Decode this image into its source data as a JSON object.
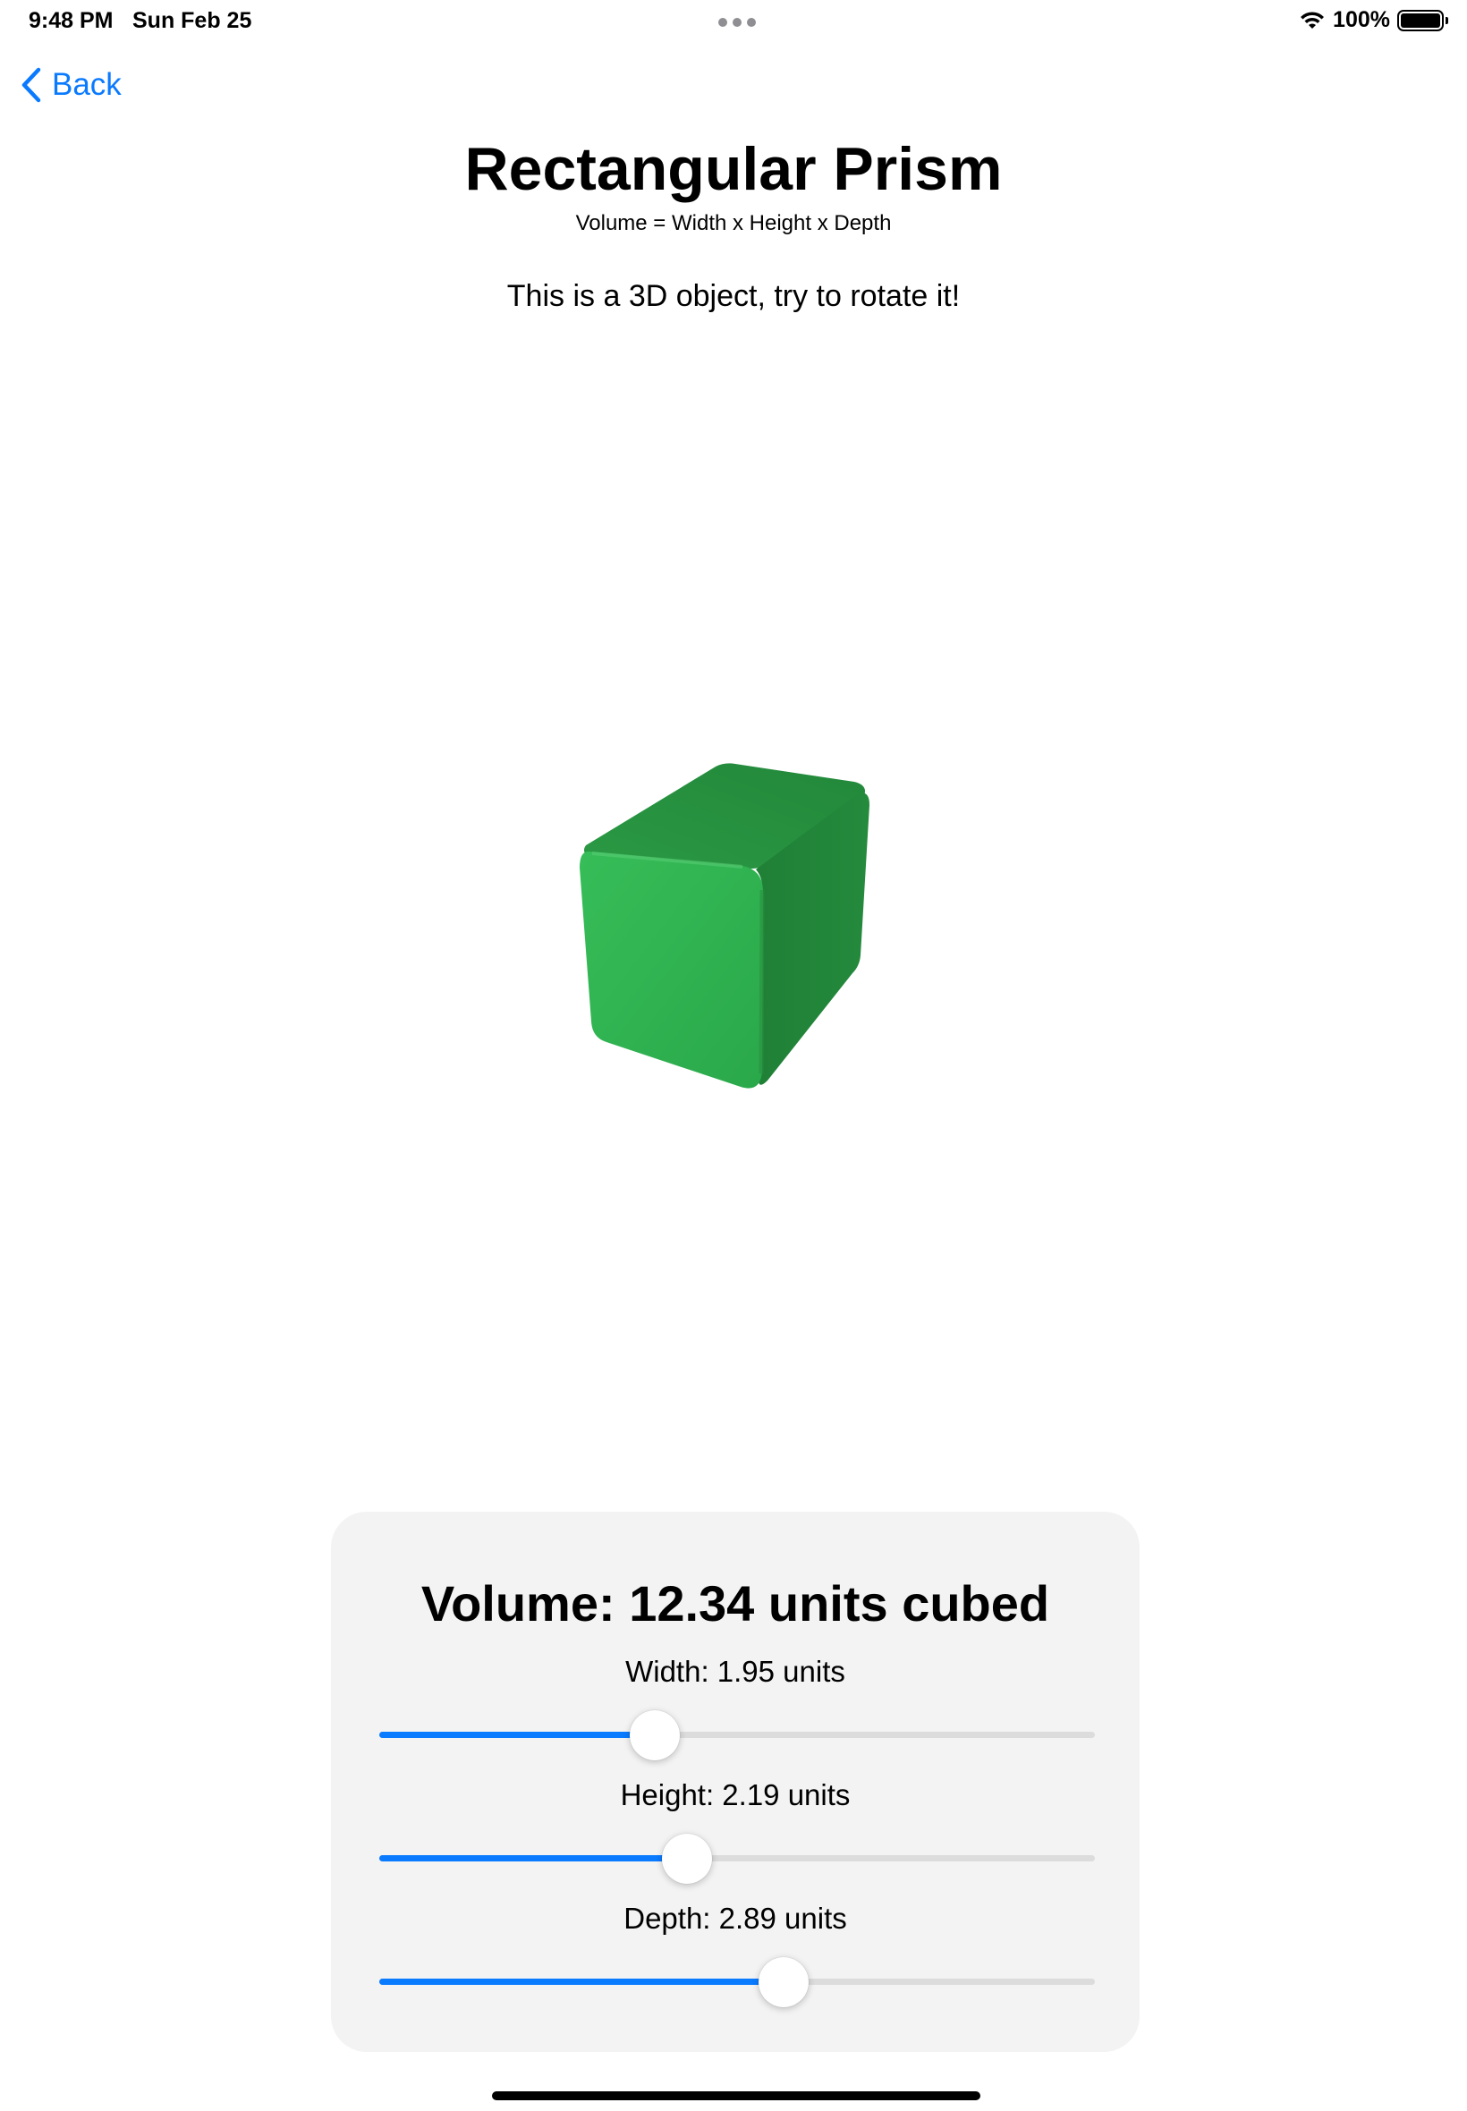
{
  "status_bar": {
    "time": "9:48 PM",
    "date": "Sun Feb 25",
    "battery_text": "100%"
  },
  "nav": {
    "back_label": "Back"
  },
  "header": {
    "title": "Rectangular Prism",
    "formula": "Volume = Width x Height x Depth",
    "hint": "This is a 3D object, try to rotate it!"
  },
  "model": {
    "shape": "rectangular prism",
    "colors": {
      "front": "#2fb350",
      "side": "#21873a",
      "top": "#248f3d"
    }
  },
  "controls": {
    "volume_text": "Volume: 12.34 units cubed",
    "sliders": [
      {
        "label": "Width: 1.95 units",
        "fraction": 0.385
      },
      {
        "label": "Height: 2.19 units",
        "fraction": 0.43
      },
      {
        "label": "Depth: 2.89 units",
        "fraction": 0.565
      }
    ]
  },
  "colors": {
    "accent": "#0a7aff",
    "panel_bg": "#f3f3f3",
    "track": "#dcdcdc"
  }
}
